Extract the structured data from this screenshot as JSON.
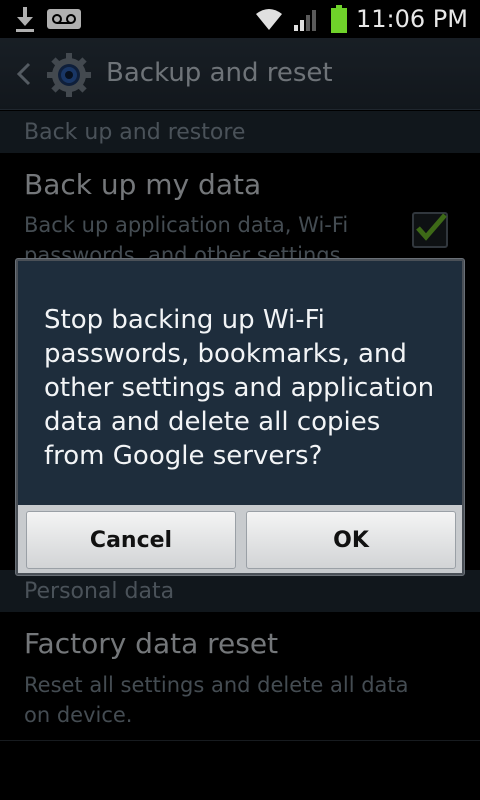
{
  "status_bar": {
    "time": "11:06 PM",
    "icons": [
      "download-icon",
      "voicemail-icon",
      "wifi-icon",
      "signal-icon",
      "battery-icon"
    ]
  },
  "action_bar": {
    "title": "Backup and reset",
    "icon": "gear-icon"
  },
  "sections": {
    "backup_restore": "Back up and restore",
    "personal_data": "Personal data"
  },
  "items": {
    "backup": {
      "title": "Back up my data",
      "subtitle_line1": "Back up application data, Wi-Fi",
      "subtitle_line2": "passwords, and other settings",
      "checked": true
    },
    "factory_reset": {
      "title": "Factory data reset",
      "subtitle_line1": "Reset all settings and delete all data",
      "subtitle_line2": "on device."
    }
  },
  "dialog": {
    "message": "Stop backing up Wi-Fi passwords, bookmarks, and other settings and application data and delete all copies from Google servers?",
    "cancel_label": "Cancel",
    "ok_label": "OK"
  },
  "colors": {
    "checkmark": "#6fbf2a",
    "dialog_bg": "#1e2d3c"
  }
}
